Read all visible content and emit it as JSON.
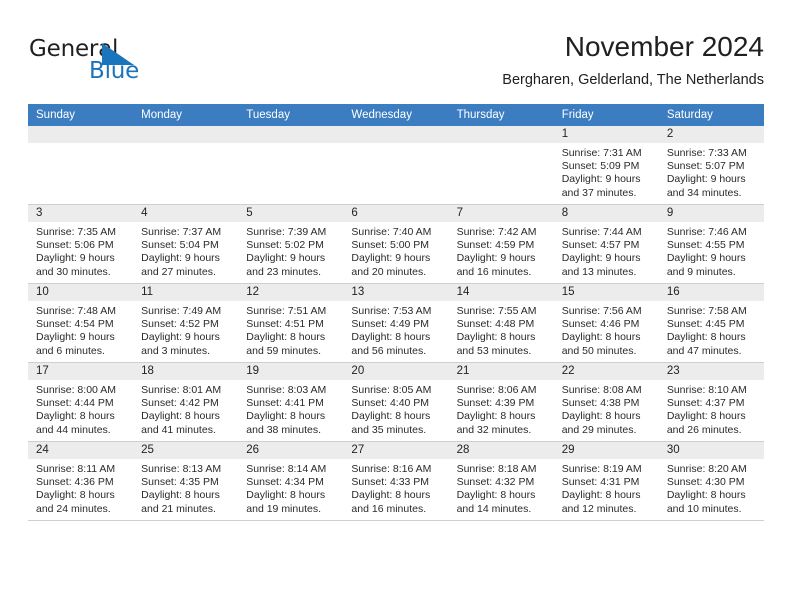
{
  "brand": {
    "name_part1": "General",
    "name_part2": "Blue",
    "accent_color": "#1b75bb",
    "triangle_icon": "triangle-icon"
  },
  "header": {
    "title": "November 2024",
    "subtitle": "Bergharen, Gelderland, The Netherlands"
  },
  "calendar": {
    "header_bg": "#3b7dc0",
    "daynum_bg": "#ececec",
    "weekday_headers": [
      "Sunday",
      "Monday",
      "Tuesday",
      "Wednesday",
      "Thursday",
      "Friday",
      "Saturday"
    ],
    "weeks": [
      [
        {
          "day": "",
          "empty": true
        },
        {
          "day": "",
          "empty": true
        },
        {
          "day": "",
          "empty": true
        },
        {
          "day": "",
          "empty": true
        },
        {
          "day": "",
          "empty": true
        },
        {
          "day": "1",
          "sunrise": "Sunrise: 7:31 AM",
          "sunset": "Sunset: 5:09 PM",
          "daylight": "Daylight: 9 hours and 37 minutes."
        },
        {
          "day": "2",
          "sunrise": "Sunrise: 7:33 AM",
          "sunset": "Sunset: 5:07 PM",
          "daylight": "Daylight: 9 hours and 34 minutes."
        }
      ],
      [
        {
          "day": "3",
          "sunrise": "Sunrise: 7:35 AM",
          "sunset": "Sunset: 5:06 PM",
          "daylight": "Daylight: 9 hours and 30 minutes."
        },
        {
          "day": "4",
          "sunrise": "Sunrise: 7:37 AM",
          "sunset": "Sunset: 5:04 PM",
          "daylight": "Daylight: 9 hours and 27 minutes."
        },
        {
          "day": "5",
          "sunrise": "Sunrise: 7:39 AM",
          "sunset": "Sunset: 5:02 PM",
          "daylight": "Daylight: 9 hours and 23 minutes."
        },
        {
          "day": "6",
          "sunrise": "Sunrise: 7:40 AM",
          "sunset": "Sunset: 5:00 PM",
          "daylight": "Daylight: 9 hours and 20 minutes."
        },
        {
          "day": "7",
          "sunrise": "Sunrise: 7:42 AM",
          "sunset": "Sunset: 4:59 PM",
          "daylight": "Daylight: 9 hours and 16 minutes."
        },
        {
          "day": "8",
          "sunrise": "Sunrise: 7:44 AM",
          "sunset": "Sunset: 4:57 PM",
          "daylight": "Daylight: 9 hours and 13 minutes."
        },
        {
          "day": "9",
          "sunrise": "Sunrise: 7:46 AM",
          "sunset": "Sunset: 4:55 PM",
          "daylight": "Daylight: 9 hours and 9 minutes."
        }
      ],
      [
        {
          "day": "10",
          "sunrise": "Sunrise: 7:48 AM",
          "sunset": "Sunset: 4:54 PM",
          "daylight": "Daylight: 9 hours and 6 minutes."
        },
        {
          "day": "11",
          "sunrise": "Sunrise: 7:49 AM",
          "sunset": "Sunset: 4:52 PM",
          "daylight": "Daylight: 9 hours and 3 minutes."
        },
        {
          "day": "12",
          "sunrise": "Sunrise: 7:51 AM",
          "sunset": "Sunset: 4:51 PM",
          "daylight": "Daylight: 8 hours and 59 minutes."
        },
        {
          "day": "13",
          "sunrise": "Sunrise: 7:53 AM",
          "sunset": "Sunset: 4:49 PM",
          "daylight": "Daylight: 8 hours and 56 minutes."
        },
        {
          "day": "14",
          "sunrise": "Sunrise: 7:55 AM",
          "sunset": "Sunset: 4:48 PM",
          "daylight": "Daylight: 8 hours and 53 minutes."
        },
        {
          "day": "15",
          "sunrise": "Sunrise: 7:56 AM",
          "sunset": "Sunset: 4:46 PM",
          "daylight": "Daylight: 8 hours and 50 minutes."
        },
        {
          "day": "16",
          "sunrise": "Sunrise: 7:58 AM",
          "sunset": "Sunset: 4:45 PM",
          "daylight": "Daylight: 8 hours and 47 minutes."
        }
      ],
      [
        {
          "day": "17",
          "sunrise": "Sunrise: 8:00 AM",
          "sunset": "Sunset: 4:44 PM",
          "daylight": "Daylight: 8 hours and 44 minutes."
        },
        {
          "day": "18",
          "sunrise": "Sunrise: 8:01 AM",
          "sunset": "Sunset: 4:42 PM",
          "daylight": "Daylight: 8 hours and 41 minutes."
        },
        {
          "day": "19",
          "sunrise": "Sunrise: 8:03 AM",
          "sunset": "Sunset: 4:41 PM",
          "daylight": "Daylight: 8 hours and 38 minutes."
        },
        {
          "day": "20",
          "sunrise": "Sunrise: 8:05 AM",
          "sunset": "Sunset: 4:40 PM",
          "daylight": "Daylight: 8 hours and 35 minutes."
        },
        {
          "day": "21",
          "sunrise": "Sunrise: 8:06 AM",
          "sunset": "Sunset: 4:39 PM",
          "daylight": "Daylight: 8 hours and 32 minutes."
        },
        {
          "day": "22",
          "sunrise": "Sunrise: 8:08 AM",
          "sunset": "Sunset: 4:38 PM",
          "daylight": "Daylight: 8 hours and 29 minutes."
        },
        {
          "day": "23",
          "sunrise": "Sunrise: 8:10 AM",
          "sunset": "Sunset: 4:37 PM",
          "daylight": "Daylight: 8 hours and 26 minutes."
        }
      ],
      [
        {
          "day": "24",
          "sunrise": "Sunrise: 8:11 AM",
          "sunset": "Sunset: 4:36 PM",
          "daylight": "Daylight: 8 hours and 24 minutes."
        },
        {
          "day": "25",
          "sunrise": "Sunrise: 8:13 AM",
          "sunset": "Sunset: 4:35 PM",
          "daylight": "Daylight: 8 hours and 21 minutes."
        },
        {
          "day": "26",
          "sunrise": "Sunrise: 8:14 AM",
          "sunset": "Sunset: 4:34 PM",
          "daylight": "Daylight: 8 hours and 19 minutes."
        },
        {
          "day": "27",
          "sunrise": "Sunrise: 8:16 AM",
          "sunset": "Sunset: 4:33 PM",
          "daylight": "Daylight: 8 hours and 16 minutes."
        },
        {
          "day": "28",
          "sunrise": "Sunrise: 8:18 AM",
          "sunset": "Sunset: 4:32 PM",
          "daylight": "Daylight: 8 hours and 14 minutes."
        },
        {
          "day": "29",
          "sunrise": "Sunrise: 8:19 AM",
          "sunset": "Sunset: 4:31 PM",
          "daylight": "Daylight: 8 hours and 12 minutes."
        },
        {
          "day": "30",
          "sunrise": "Sunrise: 8:20 AM",
          "sunset": "Sunset: 4:30 PM",
          "daylight": "Daylight: 8 hours and 10 minutes."
        }
      ]
    ]
  }
}
